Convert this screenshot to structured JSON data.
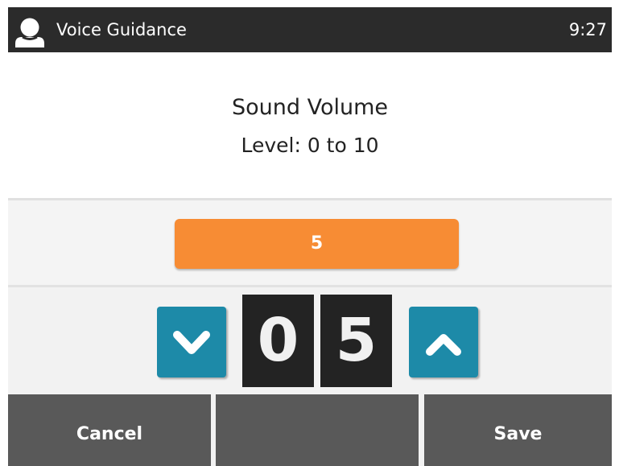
{
  "titlebar": {
    "icon": "user-icon",
    "title": "Voice Guidance",
    "time": "9:27"
  },
  "info": {
    "title": "Sound Volume",
    "range": "Level: 0 to 10"
  },
  "volume": {
    "value_label": "5",
    "digit_tens": "0",
    "digit_ones": "5",
    "decrease_icon": "chevron-down-icon",
    "increase_icon": "chevron-up-icon"
  },
  "softkeys": {
    "left": "Cancel",
    "middle": "",
    "right": "Save"
  },
  "colors": {
    "title_bar": "#2b2b2b",
    "accent_orange": "#f78c34",
    "spin_button": "#1d8aa8",
    "digit_background": "#232323",
    "softkey_background": "#595959"
  }
}
